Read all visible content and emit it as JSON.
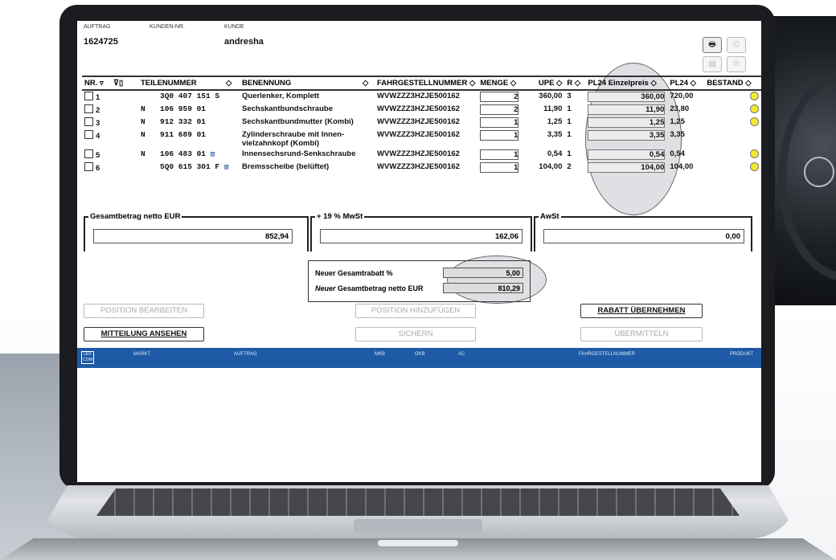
{
  "header": {
    "auftrag_label": "AUFTRAG",
    "auftrag_value": "1624725",
    "kundennr_label": "KUNDEN-NR.",
    "kunde_label": "KUNDE",
    "kunde_value": "andresha"
  },
  "toolbar": {
    "icons": [
      "printer-icon",
      "print-preview-icon",
      "keyboard-icon",
      "toggle-icon"
    ]
  },
  "table": {
    "headers": {
      "nr": "NR. ▿",
      "filter": "⊽▯",
      "teilenummer": "TEILENUMMER",
      "tn_sort": "◇",
      "benennung": "BENENNUNG",
      "ben_sort": "◇",
      "fahrgestell": "FAHRGESTELLNUMMER ◇",
      "menge": "MENGE ◇",
      "upe": "UPE ◇",
      "r": "R ◇",
      "pl24_ep": "PL24 Einzelpreis ◇",
      "pl24": "PL24 ◇",
      "bestand": "BESTAND ◇"
    },
    "rows": [
      {
        "nr": "1",
        "pre": "",
        "teil": "3Q0 407 151 S",
        "benennung": "Querlenker, Komplett",
        "benennung2": "",
        "fgn": "WVWZZZ3HZJE500162",
        "menge": "2",
        "upe": "360,00",
        "r": "3",
        "ep": "360,00",
        "pl24": "720,00"
      },
      {
        "nr": "2",
        "pre": "N",
        "teil": "106 959 01",
        "benennung": "Sechskantbundschraube",
        "benennung2": "",
        "fgn": "WVWZZZ3HZJE500162",
        "menge": "2",
        "upe": "11,90",
        "r": "1",
        "ep": "11,90",
        "pl24": "23,80"
      },
      {
        "nr": "3",
        "pre": "N",
        "teil": "912 332 01",
        "benennung": "Sechskantbundmutter (Kombi)",
        "benennung2": "",
        "fgn": "WVWZZZ3HZJE500162",
        "menge": "1",
        "upe": "1,25",
        "r": "1",
        "ep": "1,25",
        "pl24": "1,25"
      },
      {
        "nr": "4",
        "pre": "N",
        "teil": "911 689 01",
        "benennung": "Zylinderschraube mit Innen-",
        "benennung2": "vielzahnkopf (Kombi)",
        "fgn": "WVWZZZ3HZJE500162",
        "menge": "1",
        "upe": "3,35",
        "r": "1",
        "ep": "3,35",
        "pl24": "3,35"
      },
      {
        "nr": "5",
        "pre": "N",
        "teil": "106 483 01",
        "benennung": "Innensechsrund-Senkschraube",
        "benennung2": "",
        "fgn": "WVWZZZ3HZJE500162",
        "menge": "1",
        "upe": "0,54",
        "r": "1",
        "ep": "0,54",
        "pl24": "0,54"
      },
      {
        "nr": "6",
        "pre": "",
        "teil": "5Q0 615 301 F",
        "benennung": "Bremsscheibe (belüftet)",
        "benennung2": "",
        "fgn": "WVWZZZ3HZJE500162",
        "menge": "1",
        "upe": "104,00",
        "r": "2",
        "ep": "104,00",
        "pl24": "104,00"
      }
    ]
  },
  "totals": {
    "netto_label": "Gesamtbetrag netto EUR",
    "netto_value": "852,94",
    "mwst_label": "+ 19 % MwSt",
    "mwst_value": "162,06",
    "awst_label": "AwSt",
    "awst_value": "0,00"
  },
  "rabatt": {
    "prozent_label": "Neuer Gesamtrabatt %",
    "prozent_value": "5,00",
    "netto_prefix": "Neuer",
    "netto_label": " Gesamtbetrag netto EUR",
    "netto_value": "810,29"
  },
  "buttons": {
    "position_bearbeiten": "POSITION BEARBEITEN",
    "position_hinzufuegen": "POSITION HINZUFÜGEN",
    "rabatt_uebernehmen": "RABATT ÜBERNEHMEN",
    "mitteilung_ansehen": "MITTEILUNG ANSEHEN",
    "sichern": "SICHERN",
    "uebermitteln": "ÜBERMITTELN"
  },
  "footer_bar": {
    "logo": "LEX COM",
    "markt": "MARKT",
    "auftrag": "AUFTRAG",
    "mkb": "MKB",
    "gkb": "GKB",
    "ac": "AC",
    "fahrgestell": "FAHRGESTELLNUMMER",
    "produkt": "PRODUKT"
  }
}
